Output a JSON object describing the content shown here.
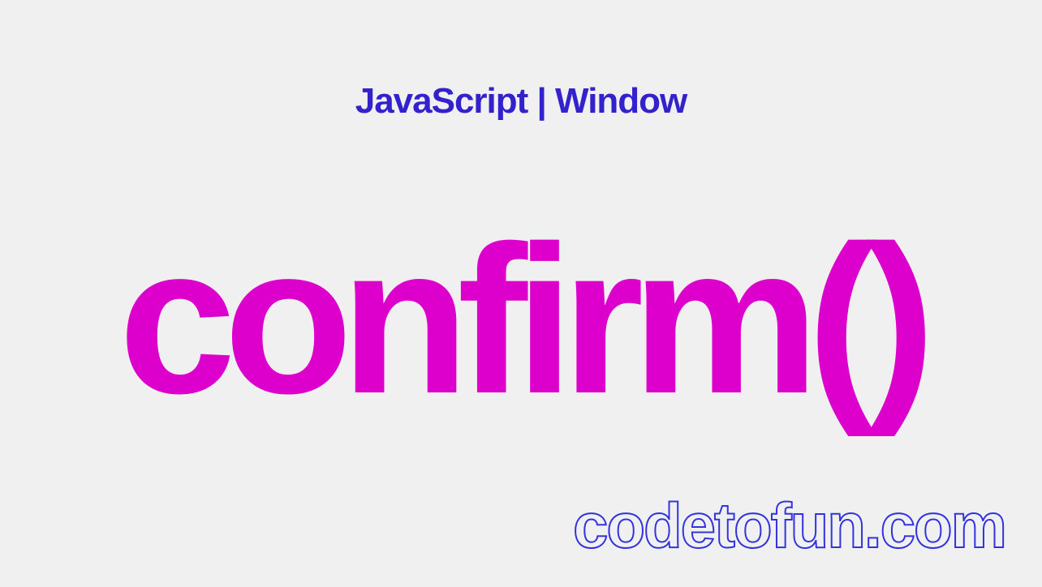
{
  "header": "JavaScript | Window",
  "main": "confirm()",
  "footer": "codetofun.com"
}
